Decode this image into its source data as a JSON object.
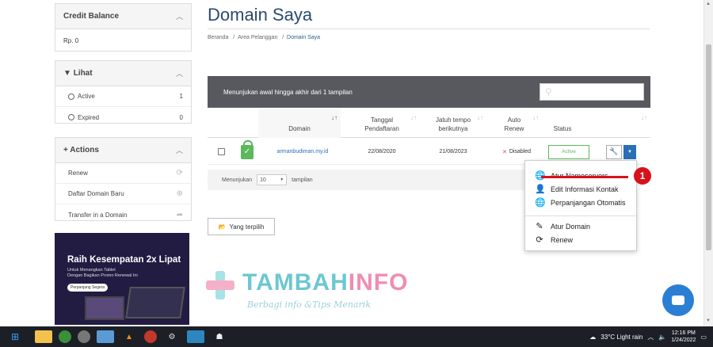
{
  "sidebar": {
    "credit": {
      "title": "Credit Balance",
      "value": "Rp. 0"
    },
    "view": {
      "title": "Lihat",
      "items": [
        {
          "label": "Active",
          "count": "1"
        },
        {
          "label": "Expired",
          "count": "0"
        }
      ]
    },
    "actions": {
      "title": "Actions",
      "items": [
        {
          "label": "Renew"
        },
        {
          "label": "Daftar Domain Baru"
        },
        {
          "label": "Transfer in a Domain"
        }
      ]
    }
  },
  "promo": {
    "title": "Raih Kesempatan 2x Lipat",
    "line1": "Untuk Menangkan Tablet",
    "line2": "Dengan Bagikan Promo Renewal Ini",
    "button": "Perpanjang Segera"
  },
  "header": {
    "title": "Domain Saya",
    "breadcrumb": [
      "Beranda",
      "Area Pelanggan",
      "Domain Saya"
    ]
  },
  "table": {
    "summary": "Menunjukan awal hingga akhir dari 1 tampilan",
    "columns": {
      "domain": "Domain",
      "reg_line1": "Tanggal",
      "reg_line2": "Pendaftaran",
      "due_line1": "Jatuh tempo",
      "due_line2": "berikutnya",
      "renew_line1": "Auto",
      "renew_line2": "Renew",
      "status": "Status"
    },
    "row": {
      "domain": "armanbudiman.my.id",
      "registered": "22/08/2020",
      "due": "21/08/2023",
      "auto_renew": "Disabled",
      "status": "Active"
    },
    "footer": {
      "show": "Menunjukan",
      "per_page": "10",
      "suffix": "tampilan"
    }
  },
  "dropdown": {
    "items": [
      {
        "label": "Atur Nameservers",
        "icon": "globe-icon"
      },
      {
        "label": "Edit Informasi Kontak",
        "icon": "user-icon"
      },
      {
        "label": "Perpanjangan Otomatis",
        "icon": "globe-icon"
      },
      {
        "label": "Atur Domain",
        "icon": "pencil-icon"
      },
      {
        "label": "Renew",
        "icon": "refresh-icon"
      }
    ]
  },
  "selected_button": "Yang terpilih",
  "annotation": {
    "number": "1"
  },
  "watermark": {
    "brand_a": "TAMBAH",
    "brand_b": "INFO",
    "tagline": "Berbagi info &Tips Menarik"
  },
  "taskbar": {
    "weather": "33°C  Light rain",
    "time": "12:16 PM",
    "date": "1/24/2022"
  },
  "colors": {
    "accent": "#2a6fb8",
    "title": "#2a4a6e",
    "active": "#5cb85c",
    "annotation": "#d8111b"
  }
}
